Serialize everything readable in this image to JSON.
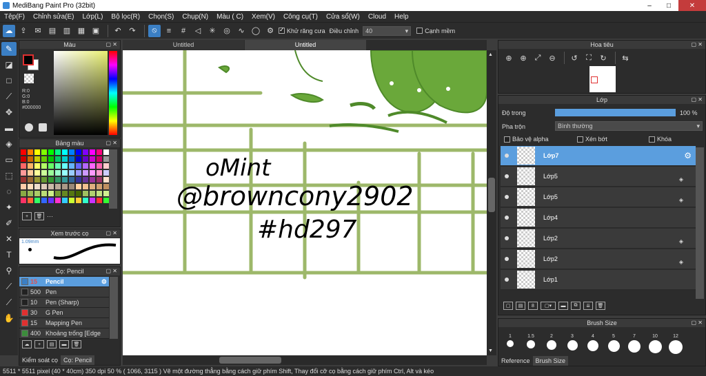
{
  "window": {
    "title": "MediBang Paint Pro (32bit)",
    "min": "–",
    "max": "□",
    "close": "✕"
  },
  "menu": [
    "Tệp(F)",
    "Chỉnh sửa(E)",
    "Lớp(L)",
    "Bộ lọc(R)",
    "Chọn(S)",
    "Chụp(N)",
    "Màu ( C)",
    "Xem(V)",
    "Công cụ(T)",
    "Cửa sổ(W)",
    "Cloud",
    "Help"
  ],
  "toolbar": {
    "antialias_label": "Khử răng cưa",
    "correction_label": "Điều chỉnh",
    "correction_value": "40",
    "snap_label": "Cạnh mềm"
  },
  "tabs": [
    "Untitled",
    "Untitled"
  ],
  "color_panel": {
    "title": "Màu",
    "r": "R:0",
    "g": "G:0",
    "b": "B:0",
    "hex": "#000000"
  },
  "palette_panel": {
    "title": "Bảng màu",
    "more": "···"
  },
  "preview_panel": {
    "title": "Xem trước cọ",
    "size": "1.09mm"
  },
  "brush_panel": {
    "title": "Cọ: Pencil",
    "items": [
      {
        "size": "15",
        "name": "Pencil",
        "color": "#3b7fc4"
      },
      {
        "size": "500",
        "name": "Pen",
        "color": "#222222"
      },
      {
        "size": "10",
        "name": "Pen (Sharp)",
        "color": "#222222"
      },
      {
        "size": "30",
        "name": "G Pen",
        "color": "#e03030"
      },
      {
        "size": "15",
        "name": "Mapping Pen",
        "color": "#e03030"
      },
      {
        "size": "400",
        "name": "Khoảng trống [Edge",
        "color": "#e03030"
      }
    ],
    "tab1": "Kiểm soát cọ",
    "tab2": "Cọ: Pencil"
  },
  "canvas": {
    "text1": "oMint",
    "text2": "@browncony2902",
    "text3": "#hd297"
  },
  "nav_panel": {
    "title": "Hoa tiêu"
  },
  "layer_panel": {
    "title": "Lớp",
    "opacity_label": "Độ trong",
    "opacity_value": "100 %",
    "opacity": 1.0,
    "blend_label": "Pha trộn",
    "blend_value": "Bình thường",
    "protect_alpha": "Bảo vệ alpha",
    "clipping": "Xén bớt",
    "lock": "Khóa",
    "layers": [
      "Lớp7",
      "Lớp5",
      "Lớp5",
      "Lớp4",
      "Lớp2",
      "Lớp2",
      "Lớp1"
    ]
  },
  "brushsize_panel": {
    "title": "Brush Size",
    "sizes": [
      "1",
      "1.5",
      "2",
      "3",
      "4",
      "5",
      "7",
      "10",
      "12"
    ],
    "tab1": "Reference",
    "tab2": "Brush Size"
  },
  "status": "5511 * 5511 pixel  (40 * 40cm)  350 dpi  50 %  ( 1066, 3115 )  Vẽ một đường thẳng bằng cách giữ phím Shift, Thay đổi cỡ cọ bằng cách giữ phím Ctrl, Alt và kéo",
  "colors": {
    "accent": "#5b9ede",
    "grid_green": "#9db86a",
    "leaf_green": "#6aa83a"
  }
}
